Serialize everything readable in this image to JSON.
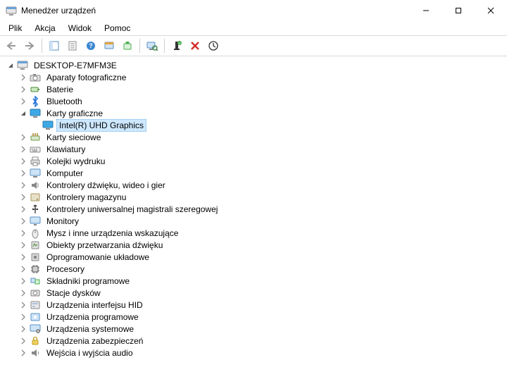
{
  "window": {
    "title": "Menedżer urządzeń"
  },
  "menu": {
    "file": "Plik",
    "action": "Akcja",
    "view": "Widok",
    "help": "Pomoc"
  },
  "toolbar": {
    "back": "back",
    "forward": "forward",
    "show_hide": "show-hide",
    "properties": "properties",
    "help": "help",
    "update": "update",
    "uninstall": "uninstall",
    "scan": "scan",
    "add_legacy": "add-legacy",
    "disable": "disable",
    "events": "events"
  },
  "tree": {
    "root": "DESKTOP-E7MFM3E",
    "nodes": [
      {
        "icon": "camera",
        "label": "Aparaty fotograficzne",
        "expandable": true
      },
      {
        "icon": "battery",
        "label": "Baterie",
        "expandable": true
      },
      {
        "icon": "bluetooth",
        "label": "Bluetooth",
        "expandable": true
      },
      {
        "icon": "display",
        "label": "Karty graficzne",
        "expandable": true,
        "expanded": true,
        "children": [
          {
            "icon": "display",
            "label": "Intel(R) UHD Graphics",
            "selected": true
          }
        ]
      },
      {
        "icon": "network",
        "label": "Karty sieciowe",
        "expandable": true
      },
      {
        "icon": "keyboard",
        "label": "Klawiatury",
        "expandable": true
      },
      {
        "icon": "printqueue",
        "label": "Kolejki wydruku",
        "expandable": true
      },
      {
        "icon": "computer",
        "label": "Komputer",
        "expandable": true
      },
      {
        "icon": "sound",
        "label": "Kontrolery dźwięku, wideo i gier",
        "expandable": true
      },
      {
        "icon": "storage-ctrl",
        "label": "Kontrolery magazynu",
        "expandable": true
      },
      {
        "icon": "usb",
        "label": "Kontrolery uniwersalnej magistrali szeregowej",
        "expandable": true
      },
      {
        "icon": "monitor",
        "label": "Monitory",
        "expandable": true
      },
      {
        "icon": "mouse",
        "label": "Mysz i inne urządzenia wskazujące",
        "expandable": true
      },
      {
        "icon": "audio-proc",
        "label": "Obiekty przetwarzania dźwięku",
        "expandable": true
      },
      {
        "icon": "firmware",
        "label": "Oprogramowanie układowe",
        "expandable": true
      },
      {
        "icon": "cpu",
        "label": "Procesory",
        "expandable": true
      },
      {
        "icon": "software-comp",
        "label": "Składniki programowe",
        "expandable": true
      },
      {
        "icon": "disk",
        "label": "Stacje dysków",
        "expandable": true
      },
      {
        "icon": "hid",
        "label": "Urządzenia interfejsu HID",
        "expandable": true
      },
      {
        "icon": "software-dev",
        "label": "Urządzenia programowe",
        "expandable": true
      },
      {
        "icon": "system",
        "label": "Urządzenia systemowe",
        "expandable": true
      },
      {
        "icon": "security",
        "label": "Urządzenia zabezpieczeń",
        "expandable": true
      },
      {
        "icon": "audio-io",
        "label": "Wejścia i wyjścia audio",
        "expandable": true
      }
    ]
  },
  "icons": {
    "camera": "camera-icon",
    "battery": "battery-icon",
    "bluetooth": "bluetooth-icon",
    "display": "display-adapter-icon",
    "network": "network-adapter-icon",
    "keyboard": "keyboard-icon",
    "printqueue": "print-queue-icon",
    "computer": "computer-icon",
    "sound": "sound-controller-icon",
    "storage-ctrl": "storage-controller-icon",
    "usb": "usb-controller-icon",
    "monitor": "monitor-icon",
    "mouse": "mouse-icon",
    "audio-proc": "audio-processing-icon",
    "firmware": "firmware-icon",
    "cpu": "processor-icon",
    "software-comp": "software-component-icon",
    "disk": "disk-drive-icon",
    "hid": "hid-device-icon",
    "software-dev": "software-device-icon",
    "system": "system-device-icon",
    "security": "security-device-icon",
    "audio-io": "audio-io-icon",
    "root": "computer-root-icon"
  }
}
